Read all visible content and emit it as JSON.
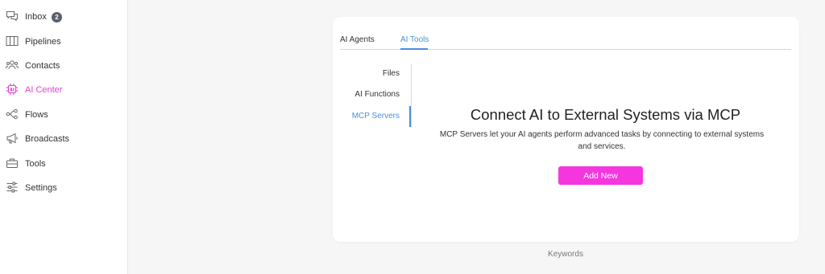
{
  "colors": {
    "accent_pink": "#e13fd2",
    "button_pink": "#f536df",
    "tab_blue": "#4a8fd8",
    "badge_gray": "#5b5f6b"
  },
  "sidebar": {
    "items": [
      {
        "label": "Inbox",
        "icon": "chat-bubbles-icon",
        "badge": "2",
        "active": false
      },
      {
        "label": "Pipelines",
        "icon": "columns-icon",
        "active": false
      },
      {
        "label": "Contacts",
        "icon": "users-icon",
        "active": false
      },
      {
        "label": "AI Center",
        "icon": "ai-chip-icon",
        "active": true
      },
      {
        "label": "Flows",
        "icon": "flow-nodes-icon",
        "active": false
      },
      {
        "label": "Broadcasts",
        "icon": "megaphone-icon",
        "active": false
      },
      {
        "label": "Tools",
        "icon": "toolbox-icon",
        "active": false
      },
      {
        "label": "Settings",
        "icon": "sliders-icon",
        "active": false
      }
    ]
  },
  "tabs": [
    {
      "label": "AI Agents",
      "active": false
    },
    {
      "label": "AI Tools",
      "active": true
    }
  ],
  "subnav": [
    {
      "label": "Files",
      "active": false
    },
    {
      "label": "AI Functions",
      "active": false
    },
    {
      "label": "MCP Servers",
      "active": true
    }
  ],
  "content": {
    "title": "Connect AI to External Systems via MCP",
    "description": "MCP Servers let your AI agents perform advanced tasks by connecting to external systems and services.",
    "button_label": "Add New"
  },
  "footer": {
    "keywords": "Keywords"
  }
}
